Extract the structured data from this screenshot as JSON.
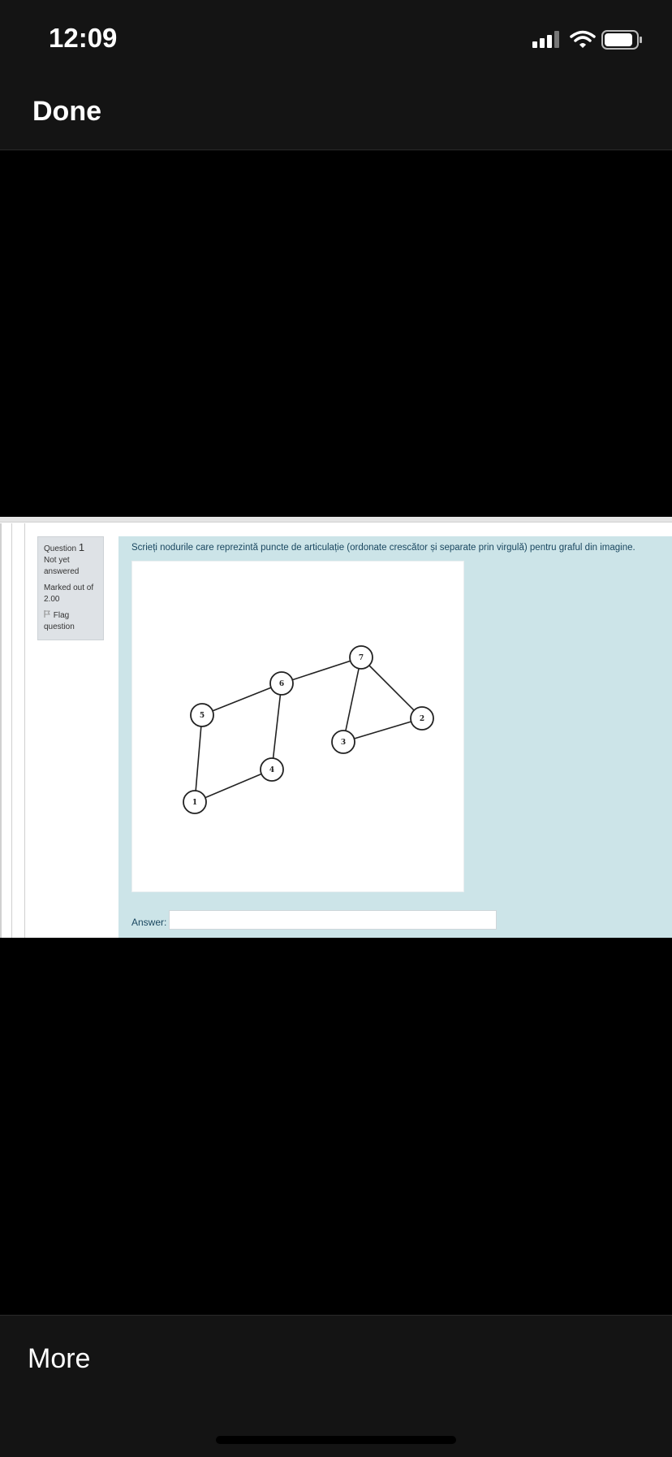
{
  "status_bar": {
    "time": "12:09",
    "icons": [
      "signal-icon",
      "wifi-icon",
      "battery-icon"
    ]
  },
  "top_bar": {
    "done_label": "Done"
  },
  "quiz": {
    "question_prefix": "Question",
    "question_number": "1",
    "status": "Not yet answered",
    "marked_out_of": "Marked out of 2.00",
    "flag_label": "Flag question",
    "question_text": "Scrieți nodurile care reprezintă puncte de articulație (ordonate crescător și separate prin virgulă) pentru graful din imagine.",
    "answer_label": "Answer:",
    "answer_value": "",
    "graph": {
      "nodes": [
        "1",
        "2",
        "3",
        "4",
        "5",
        "6",
        "7"
      ],
      "edges": [
        [
          "1",
          "5"
        ],
        [
          "1",
          "4"
        ],
        [
          "5",
          "6"
        ],
        [
          "4",
          "6"
        ],
        [
          "6",
          "7"
        ],
        [
          "7",
          "3"
        ],
        [
          "7",
          "2"
        ],
        [
          "3",
          "2"
        ]
      ]
    }
  },
  "bottom_bar": {
    "more_label": "More"
  }
}
